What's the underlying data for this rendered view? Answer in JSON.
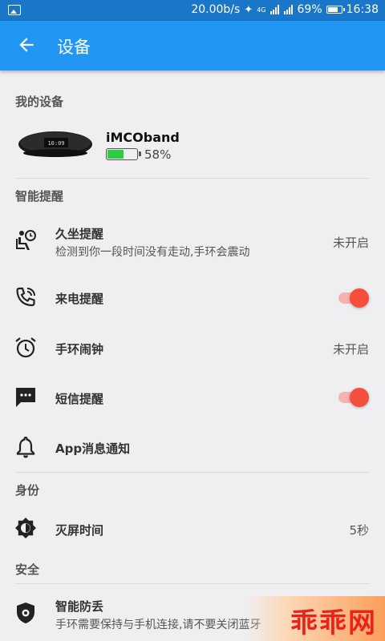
{
  "status_bar": {
    "network_speed": "20.00b/s",
    "network_type": "4G",
    "battery_pct": "69%",
    "time": "16:38"
  },
  "app_bar": {
    "title": "设备",
    "back_icon": "arrow-left-icon"
  },
  "sections": {
    "my_devices": "我的设备",
    "smart_reminders": "智能提醒",
    "identity": "身份",
    "security": "安全"
  },
  "device": {
    "name": "iMCOband",
    "battery_text": "58%",
    "battery_level": 0.58,
    "battery_color": "#2ecc40",
    "band_screen_time": "10:09"
  },
  "reminders": {
    "sedentary": {
      "label": "久坐提醒",
      "subtitle": "检测到你一段时间没有走动,手环会震动",
      "value": "未开启",
      "icon": "sedentary-icon"
    },
    "call": {
      "label": "来电提醒",
      "enabled": true,
      "icon": "phone-ring-icon"
    },
    "alarm": {
      "label": "手环闹钟",
      "value": "未开启",
      "icon": "alarm-clock-icon"
    },
    "sms": {
      "label": "短信提醒",
      "enabled": true,
      "icon": "sms-icon"
    },
    "app_notify": {
      "label": "App消息通知",
      "icon": "bell-icon"
    }
  },
  "identity_items": {
    "screen_off": {
      "label": "灭屏时间",
      "value": "5秒",
      "icon": "brightness-icon"
    }
  },
  "security_items": {
    "anti_lost": {
      "label": "智能防丢",
      "subtitle": "手环需要保持与手机连接,请不要关闭蓝牙",
      "icon": "shield-icon"
    }
  },
  "watermark": {
    "text": "乖乖网"
  },
  "colors": {
    "status_bar": "#1976c9",
    "app_bar": "#2196f3",
    "toggle_on": "#f44e3c",
    "toggle_track": "#f6b2ac",
    "background": "#efeff1"
  }
}
